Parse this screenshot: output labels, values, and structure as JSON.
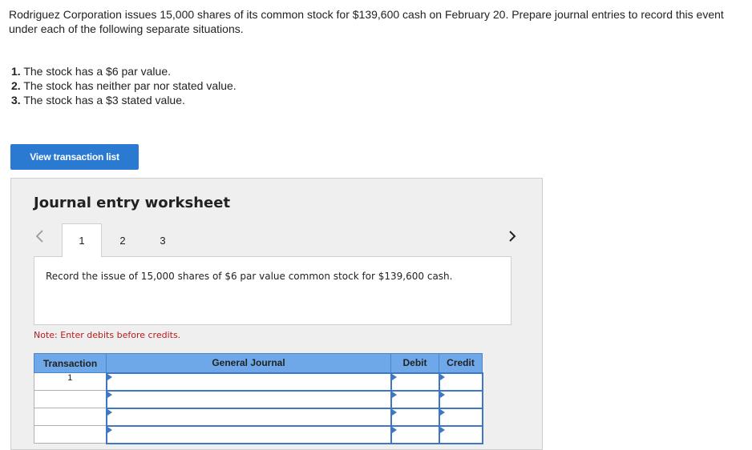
{
  "intro": "Rodriguez Corporation issues 15,000 shares of its common stock for $139,600 cash on February 20. Prepare journal entries to record this event under each of the following separate situations.",
  "requirements": [
    {
      "num": "1.",
      "text": "The stock has a $6 par value."
    },
    {
      "num": "2.",
      "text": "The stock has neither par nor stated value."
    },
    {
      "num": "3.",
      "text": "The stock has a $3 stated value."
    }
  ],
  "view_button": "View transaction list",
  "worksheet": {
    "title": "Journal entry worksheet",
    "tabs": [
      "1",
      "2",
      "3"
    ],
    "active_tab": "1",
    "instruction": "Record the issue of 15,000 shares of $6 par value common stock for $139,600 cash.",
    "note": "Note: Enter debits before credits.",
    "table": {
      "headers": [
        "Transaction",
        "General Journal",
        "Debit",
        "Credit"
      ],
      "rows": [
        {
          "transaction": "1"
        },
        {
          "transaction": ""
        },
        {
          "transaction": ""
        },
        {
          "transaction": ""
        }
      ]
    }
  },
  "colors": {
    "button": "#2a7ad2",
    "table_header": "#6fa8e8",
    "note": "#b51c1c"
  }
}
